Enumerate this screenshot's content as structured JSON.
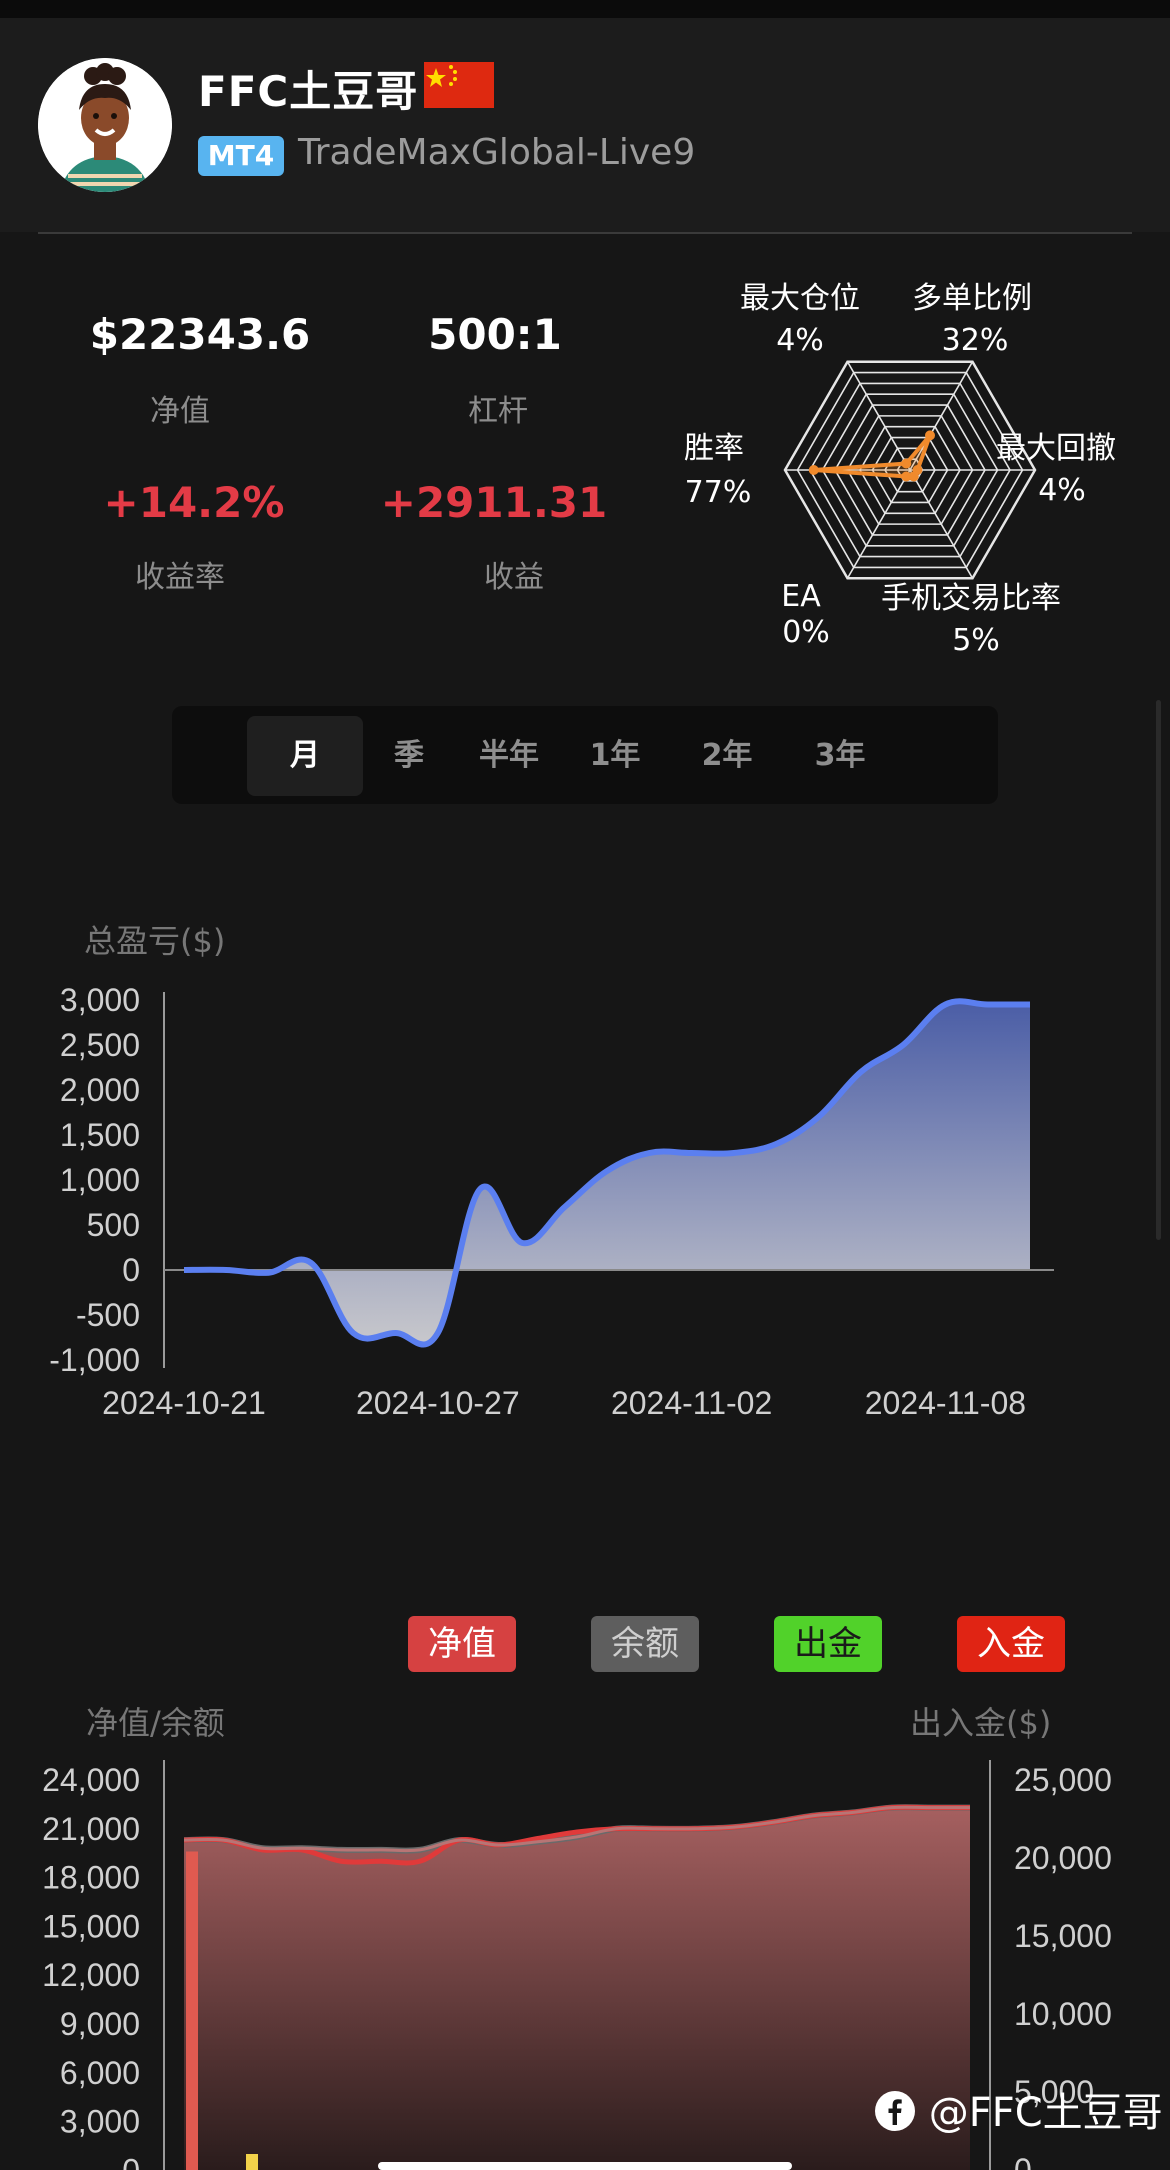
{
  "profile": {
    "name": "FFC土豆哥",
    "platform": "MT4",
    "server": "TradeMaxGlobal-Live9"
  },
  "stats": [
    {
      "value": "$22343.6",
      "label": "净值",
      "color": "#ffffff"
    },
    {
      "value": "500:1",
      "label": "杠杆",
      "color": "#ffffff"
    },
    {
      "value": "+14.2%",
      "label": "收益率",
      "color": "#e33b46"
    },
    {
      "value": "+2911.31",
      "label": "收益",
      "color": "#e33b46"
    }
  ],
  "radar": {
    "axes": [
      {
        "name": "多单比例",
        "value": "32%",
        "frac": 0.32
      },
      {
        "name": "最大回撤",
        "value": "4%",
        "frac": 0.04
      },
      {
        "name": "手机交易比率",
        "value": "5%",
        "frac": 0.05
      },
      {
        "name": "EA",
        "value": "0%",
        "frac": 0.0
      },
      {
        "name": "胜率",
        "value": "77%",
        "frac": 0.77
      },
      {
        "name": "最大仓位",
        "value": "4%",
        "frac": 0.04
      }
    ],
    "color": "#f08a2c"
  },
  "tabs": [
    "月",
    "季",
    "半年",
    "1年",
    "2年",
    "3年"
  ],
  "active_tab": "月",
  "chart_data": [
    {
      "type": "area",
      "title": "总盈亏($)",
      "x_tick_labels": [
        "2024-10-21",
        "2024-10-27",
        "2024-11-02",
        "2024-11-08"
      ],
      "x": [
        "10-21",
        "10-22",
        "10-23",
        "10-24",
        "10-25",
        "10-26",
        "10-27",
        "10-28",
        "10-29",
        "10-30",
        "10-31",
        "11-01",
        "11-02",
        "11-03",
        "11-04",
        "11-05",
        "11-06",
        "11-07",
        "11-08",
        "11-09",
        "11-10"
      ],
      "values": [
        0,
        0,
        -30,
        80,
        -700,
        -700,
        -700,
        900,
        300,
        700,
        1100,
        1300,
        1300,
        1300,
        1400,
        1700,
        2200,
        2500,
        2950,
        2950,
        2950
      ],
      "ylim": [
        -1000,
        3000
      ],
      "y_ticks": [
        3000,
        2500,
        2000,
        1500,
        1000,
        500,
        0,
        -500,
        -1000
      ],
      "y_tick_labels": [
        "3,000",
        "2,500",
        "2,000",
        "1,500",
        "1,000",
        "500",
        "0",
        "-500",
        "-1,000"
      ],
      "line_color": "#5b7ff0"
    },
    {
      "type": "area",
      "ylabel_left": "净值/余额",
      "ylabel_right": "出入金($)",
      "legend": [
        "净值",
        "余额",
        "出金",
        "入金"
      ],
      "legend_colors": [
        "#d64141",
        "#5e5e5e",
        "#51d22a",
        "#e02414"
      ],
      "series": [
        {
          "name": "净值",
          "values": [
            20300,
            20300,
            19700,
            19700,
            19000,
            19000,
            19000,
            20300,
            20000,
            20400,
            20800,
            21000,
            21000,
            21000,
            21100,
            21400,
            21800,
            22000,
            22300,
            22300,
            22300
          ]
        },
        {
          "name": "余额",
          "values": [
            20300,
            20300,
            19800,
            19800,
            19700,
            19700,
            19700,
            20300,
            20000,
            20200,
            20500,
            21000,
            21000,
            21000,
            21100,
            21400,
            21800,
            22000,
            22300,
            22300,
            22300
          ]
        }
      ],
      "ylim_left": [
        0,
        24000
      ],
      "y_tick_labels_left": [
        "24,000",
        "21,000",
        "18,000",
        "15,000",
        "12,000",
        "9,000",
        "6,000",
        "3,000",
        "0"
      ],
      "ylim_right": [
        0,
        25000
      ],
      "y_tick_labels_right": [
        "25,000",
        "20,000",
        "15,000",
        "10,000",
        "5,000",
        "0"
      ]
    }
  ],
  "watermark": "@FFC土豆哥"
}
